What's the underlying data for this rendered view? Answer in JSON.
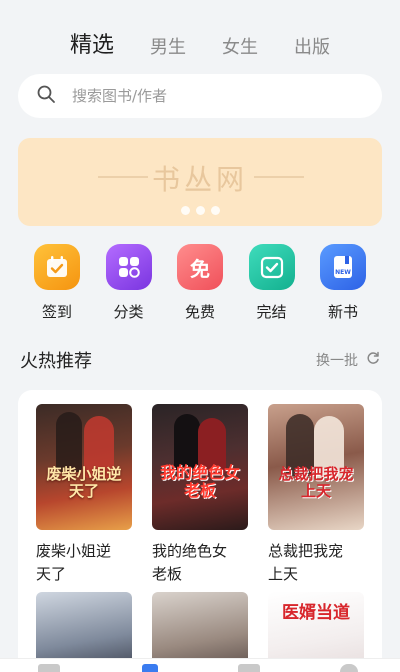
{
  "tabs": [
    {
      "label": "精选",
      "active": true
    },
    {
      "label": "男生",
      "active": false
    },
    {
      "label": "女生",
      "active": false
    },
    {
      "label": "出版",
      "active": false
    }
  ],
  "search": {
    "placeholder": "搜索图书/作者",
    "icon": "search-icon"
  },
  "banner": {
    "title": "书丛网",
    "slides": 3
  },
  "categories": [
    {
      "label": "签到",
      "icon": "calendar-check-icon",
      "color": "#f7a51a"
    },
    {
      "label": "分类",
      "icon": "grid-icon",
      "color": "#8b4be6"
    },
    {
      "label": "免费",
      "icon": "free-tag-icon",
      "color": "#f5696e"
    },
    {
      "label": "完结",
      "icon": "checkbox-icon",
      "color": "#22c4a0"
    },
    {
      "label": "新书",
      "icon": "new-book-icon",
      "color": "#3a7cf0"
    }
  ],
  "hot": {
    "title": "火热推荐",
    "refresh_label": "换一批",
    "books": [
      {
        "name_line1": "废柴小姐逆",
        "name_line2": "天了",
        "cover_text": "废柴小姐逆天了"
      },
      {
        "name_line1": "我的绝色女",
        "name_line2": "老板",
        "cover_text": "我的绝色女老板"
      },
      {
        "name_line1": "总裁把我宠",
        "name_line2": "上天",
        "cover_text": "总裁把我宠上天"
      }
    ],
    "next_row_cover_text": "医婿当道"
  }
}
